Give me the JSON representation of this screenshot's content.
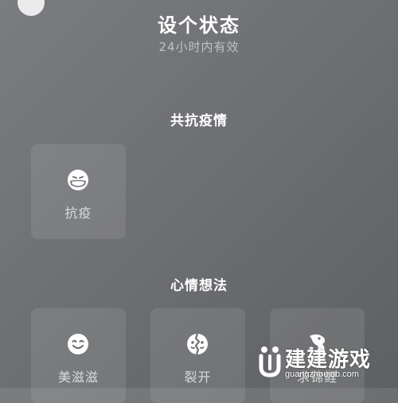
{
  "header": {
    "title": "设个状态",
    "subtitle": "24小时内有效"
  },
  "sections": [
    {
      "title": "共抗疫情",
      "items": [
        {
          "label": "抗疫",
          "icon": "masked-face-icon"
        }
      ]
    },
    {
      "title": "心情想法",
      "items": [
        {
          "label": "美滋滋",
          "icon": "smiley-face-icon"
        },
        {
          "label": "裂开",
          "icon": "cracked-face-icon"
        },
        {
          "label": "求锦鲤",
          "icon": "koi-fish-icon"
        }
      ]
    }
  ],
  "watermark": {
    "brand": "建建游戏",
    "url": "guangzhoujob.com"
  }
}
